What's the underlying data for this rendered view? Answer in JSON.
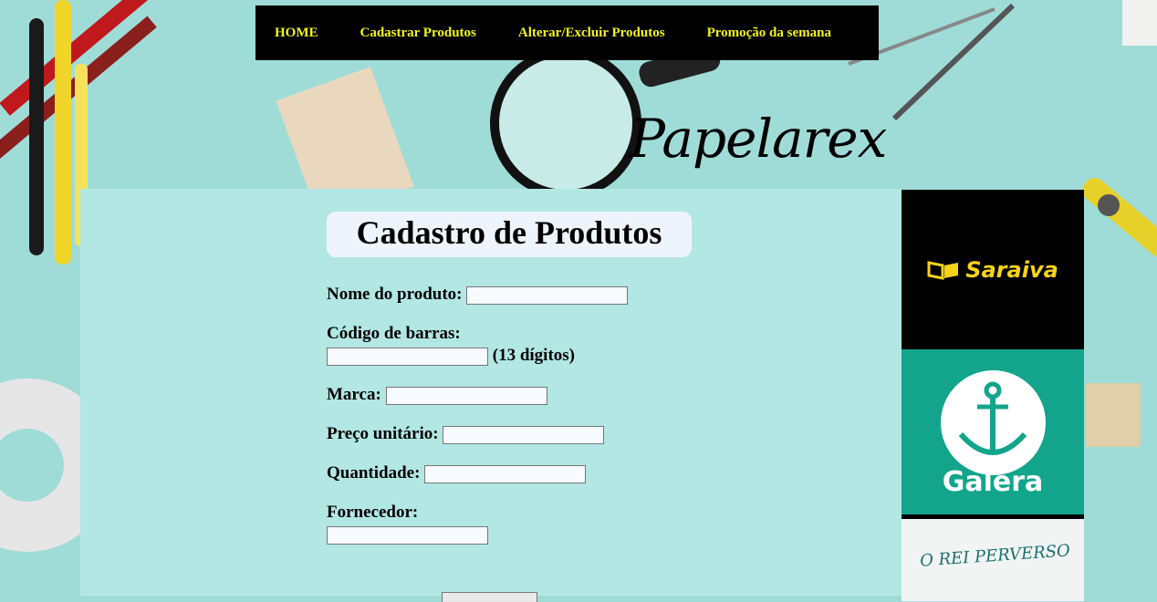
{
  "nav": {
    "items": [
      "HOME",
      "Cadastrar Produtos",
      "Alterar/Excluir Produtos",
      "Promoção da semana"
    ]
  },
  "logo": {
    "text": "Papelarex"
  },
  "form": {
    "title": "Cadastro de Produtos",
    "fields": {
      "nome": "Nome do produto:",
      "codigo": "Código de barras:",
      "codigo_hint": "(13 dígitos)",
      "marca": "Marca:",
      "preco": "Preço unitário:",
      "quantidade": "Quantidade:",
      "fornecedor": "Fornecedor:"
    }
  },
  "ads": {
    "saraiva": "Saraiva",
    "galera": "Galera",
    "books": "O REI PERVERSO"
  },
  "colors": {
    "nav_bg": "#000000",
    "nav_text": "#f4f31f",
    "panel": "#b2e7e3",
    "background": "#9fdcd8",
    "galera": "#12a58c",
    "saraiva": "#f6d31b"
  }
}
